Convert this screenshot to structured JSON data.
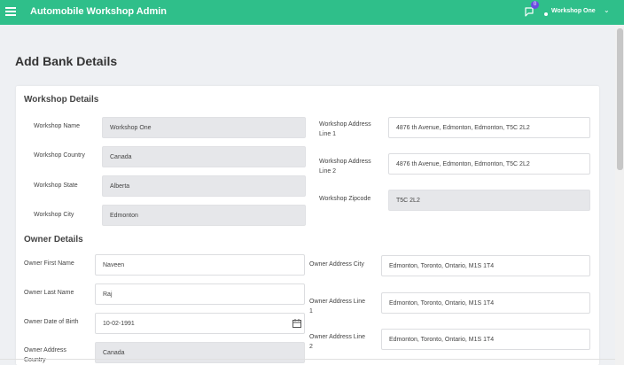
{
  "app": {
    "title": "Automobile Workshop Admin",
    "notification_count": "0",
    "user_name": "Workshop One"
  },
  "page": {
    "title": "Add Bank Details"
  },
  "workshop": {
    "section_title": "Workshop Details",
    "name_label": "Workshop Name",
    "name_value": "Workshop One",
    "country_label": "Workshop Country",
    "country_value": "Canada",
    "state_label": "Workshop State",
    "state_value": "Alberta",
    "city_label": "Workshop City",
    "city_value": "Edmonton",
    "address1_label": "Workshop Address Line 1",
    "address1_value": "4876 th Avenue, Edmonton, Edmonton, T5C 2L2",
    "address2_label": "Workshop Address Line 2",
    "address2_value": "4876 th Avenue, Edmonton, Edmonton, T5C 2L2",
    "zipcode_label": "Workshop Zipcode",
    "zipcode_value": "T5C 2L2"
  },
  "owner": {
    "section_title": "Owner Details",
    "first_name_label": "Owner First Name",
    "first_name_value": "Naveen",
    "last_name_label": "Owner Last Name",
    "last_name_value": "Raj",
    "dob_label": "Owner Date of Birth",
    "dob_value": "10-02-1991",
    "country_label": "Owner Address Country",
    "country_value": "Canada",
    "city_label": "Owner Address City",
    "city_value": "Edmonton, Toronto, Ontario, M1S 1T4",
    "line1_label": "Owner Address Line 1",
    "line1_value": "Edmonton, Toronto, Ontario, M1S 1T4",
    "line2_label": "Owner Address Line 2",
    "line2_value": "Edmonton, Toronto, Ontario, M1S 1T4"
  },
  "icons": {
    "menu": "menu-icon",
    "chat": "chat-icon",
    "calendar": "calendar-icon",
    "chevron": "chevron-down-icon"
  },
  "colors": {
    "header": "#2fbf8a",
    "badge": "#6a4be0",
    "readonly_field": "#e6e7ea"
  }
}
